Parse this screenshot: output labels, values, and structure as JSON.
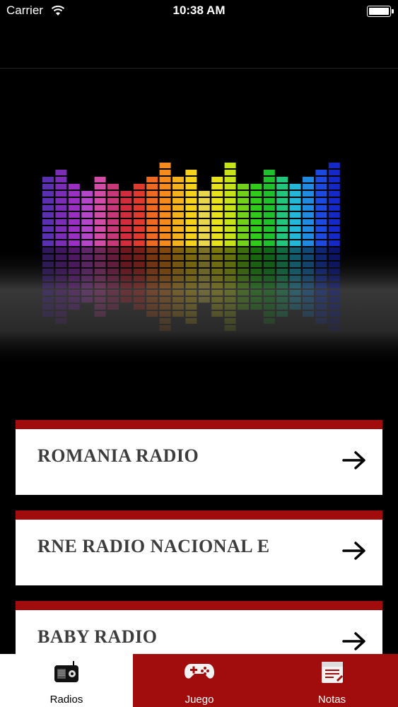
{
  "status_bar": {
    "carrier": "Carrier",
    "time": "10:38 AM"
  },
  "stations": [
    {
      "name": "ROMANIA RADIO"
    },
    {
      "name": "RNE RADIO NACIONAL E"
    },
    {
      "name": "BABY RADIO"
    }
  ],
  "tab_bar": {
    "tabs": [
      {
        "label": "Radios",
        "icon": "radio-icon",
        "selected": true
      },
      {
        "label": "Juego",
        "icon": "gamepad-icon",
        "selected": false
      },
      {
        "label": "Notas",
        "icon": "notes-icon",
        "selected": false
      }
    ]
  },
  "colors": {
    "accent_red": "#a10d0d",
    "tab_selected_bg": "#ffffff",
    "tab_unselected_bg": "#a10d0d",
    "background": "#000000"
  },
  "equalizer": {
    "levels": [
      10,
      11,
      9,
      8,
      10,
      9,
      8,
      9,
      10,
      12,
      10,
      11,
      8,
      10,
      12,
      9,
      9,
      11,
      10,
      9,
      10,
      11,
      12
    ],
    "colors": [
      "#5a2fb0",
      "#7b2db5",
      "#9b2fc4",
      "#b646c9",
      "#d04ca6",
      "#c73878",
      "#d22d3c",
      "#e03a2e",
      "#ee6a23",
      "#f58a1d",
      "#f6b21d",
      "#f7d21b",
      "#e9d64a",
      "#e8e21a",
      "#c8e21a",
      "#72d21a",
      "#2fcc1a",
      "#1ec02c",
      "#21c57b",
      "#23b7d8",
      "#1f8ae0",
      "#1c49e0",
      "#1528c8"
    ]
  }
}
